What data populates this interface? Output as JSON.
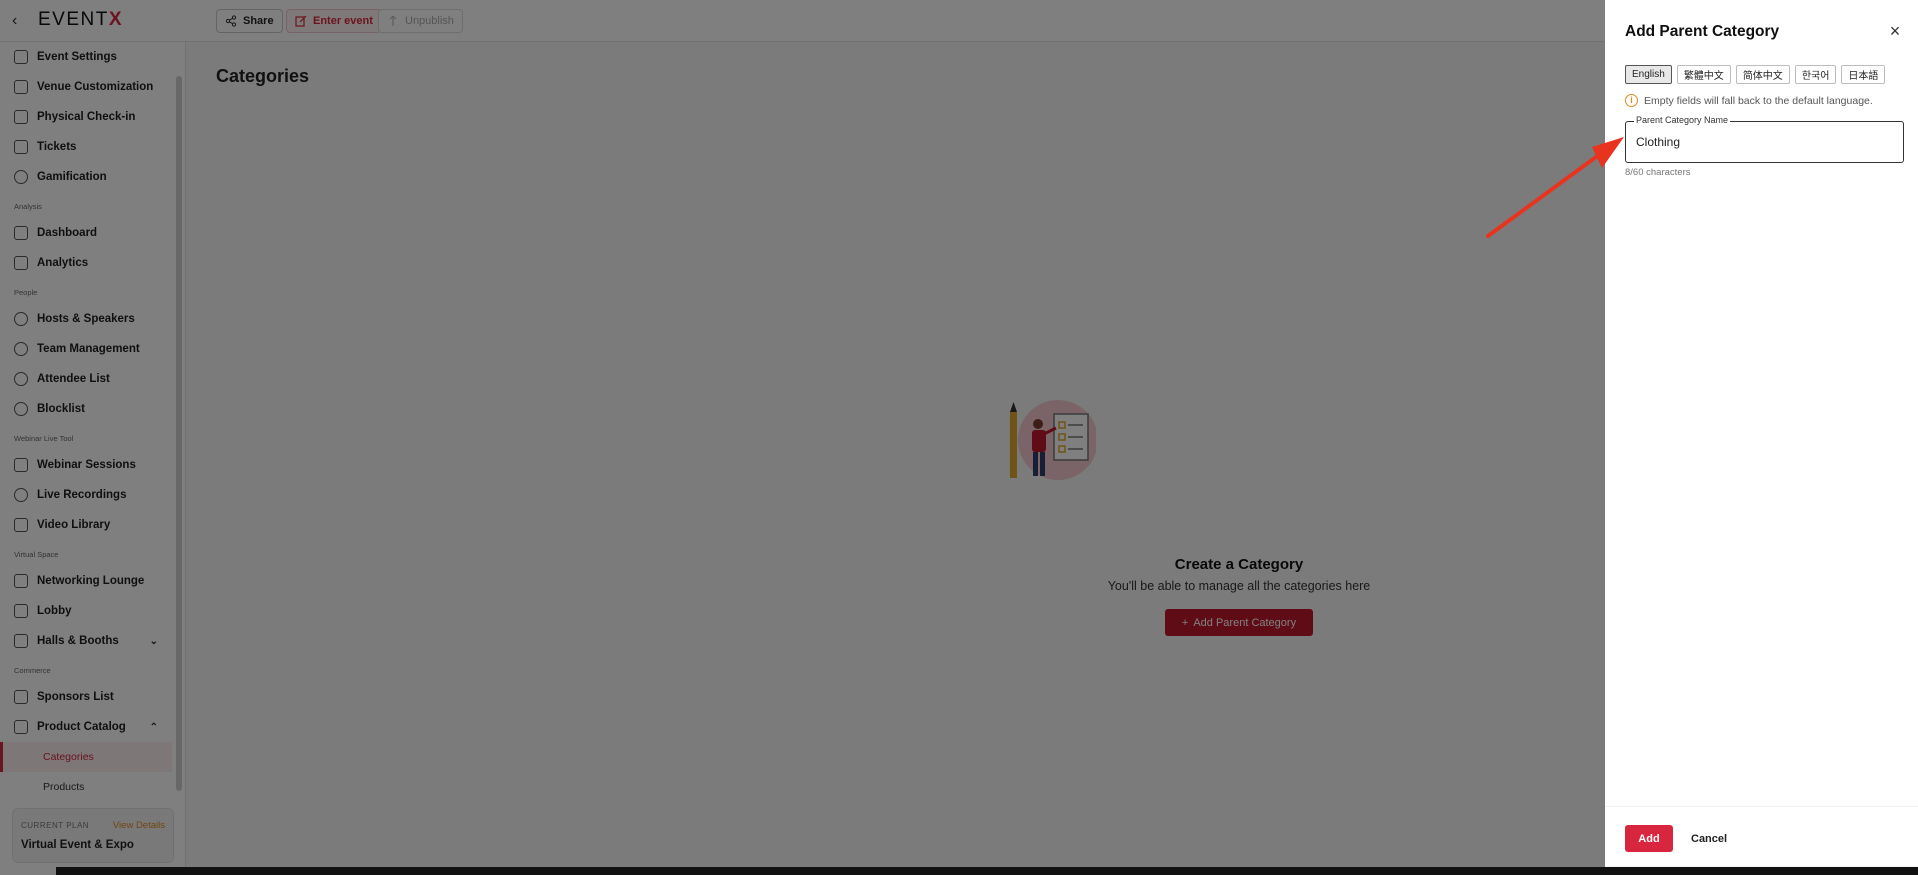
{
  "topbar": {
    "logo_text": "EVENT",
    "logo_accent": "X",
    "share_label": "Share",
    "enter_label": "Enter event",
    "unpublish_label": "Unpublish"
  },
  "sidebar": {
    "items": [
      {
        "label": "Event Settings"
      },
      {
        "label": "Venue Customization"
      },
      {
        "label": "Physical Check-in"
      },
      {
        "label": "Tickets"
      },
      {
        "label": "Gamification"
      },
      {
        "label": "Dashboard"
      },
      {
        "label": "Analytics"
      },
      {
        "label": "Hosts & Speakers"
      },
      {
        "label": "Team Management"
      },
      {
        "label": "Attendee List"
      },
      {
        "label": "Blocklist"
      },
      {
        "label": "Webinar Sessions"
      },
      {
        "label": "Live Recordings"
      },
      {
        "label": "Video Library"
      },
      {
        "label": "Networking Lounge"
      },
      {
        "label": "Lobby"
      },
      {
        "label": "Halls & Booths"
      },
      {
        "label": "Sponsors List"
      },
      {
        "label": "Product Catalog"
      }
    ],
    "sections": [
      "Analysis",
      "People",
      "Webinar Live Tool",
      "Virtual Space",
      "Commerce"
    ],
    "sub_items": [
      {
        "label": "Categories"
      },
      {
        "label": "Products"
      }
    ],
    "plan": {
      "label": "CURRENT PLAN",
      "link": "View Details",
      "name": "Virtual Event & Expo"
    }
  },
  "main": {
    "title": "Categories",
    "empty_title": "Create a Category",
    "empty_desc": "You'll be able to manage all the categories here",
    "add_button": "Add Parent Category"
  },
  "drawer": {
    "title": "Add Parent Category",
    "languages": [
      "English",
      "繁體中文",
      "简体中文",
      "한국어",
      "日本語"
    ],
    "active_language": "English",
    "notice": "Empty fields will fall back to the default language.",
    "field_label": "Parent Category Name",
    "field_value": "Clothing",
    "counter": "8/60 characters",
    "add_label": "Add",
    "cancel_label": "Cancel"
  },
  "colors": {
    "accent": "#d7263d",
    "warning": "#e08a19",
    "annotation_arrow": "#e8331f"
  }
}
